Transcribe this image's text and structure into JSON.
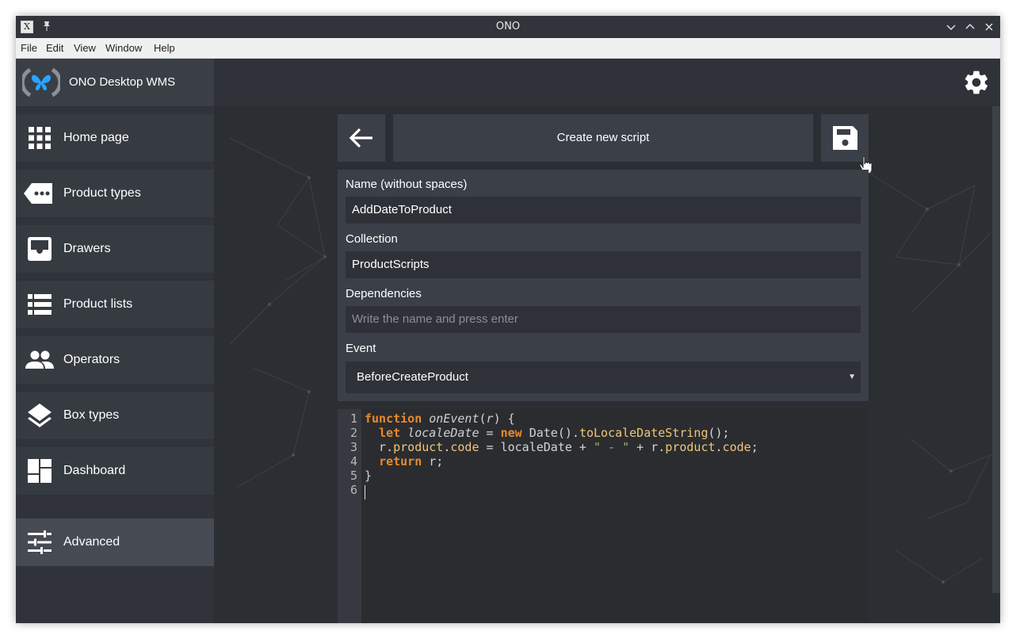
{
  "window": {
    "title": "ONO"
  },
  "menubar": {
    "items": [
      "File",
      "Edit",
      "View",
      "Window",
      "Help"
    ]
  },
  "app": {
    "brand": "ONO Desktop WMS"
  },
  "sidebar": {
    "items": [
      {
        "label": "Home page",
        "icon": "grid-icon"
      },
      {
        "label": "Product types",
        "icon": "tag-icon"
      },
      {
        "label": "Drawers",
        "icon": "inbox-icon"
      },
      {
        "label": "Product lists",
        "icon": "list-icon"
      },
      {
        "label": "Operators",
        "icon": "people-icon"
      },
      {
        "label": "Box types",
        "icon": "layers-icon"
      },
      {
        "label": "Dashboard",
        "icon": "dashboard-icon"
      },
      {
        "label": "Advanced",
        "icon": "sliders-icon",
        "active": true
      }
    ]
  },
  "toolbar": {
    "title": "Create new script"
  },
  "form": {
    "name_label": "Name (without spaces)",
    "name_value": "AddDateToProduct",
    "collection_label": "Collection",
    "collection_value": "ProductScripts",
    "dependencies_label": "Dependencies",
    "dependencies_placeholder": "Write the name and press enter",
    "event_label": "Event",
    "event_value": "BeforeCreateProduct"
  },
  "editor": {
    "line_numbers": [
      "1",
      "2",
      "3",
      "4",
      "5",
      "6"
    ],
    "lines": [
      "function onEvent(r) {",
      "  let localeDate = new Date().toLocaleDateString();",
      "  r.product.code = localeDate + \" - \" + r.product.code;",
      "  return r;",
      "}",
      ""
    ]
  },
  "colors": {
    "accent": "#1e90ff",
    "keyword": "#e8892b",
    "property": "#f0c674",
    "string": "#a8b26e"
  }
}
